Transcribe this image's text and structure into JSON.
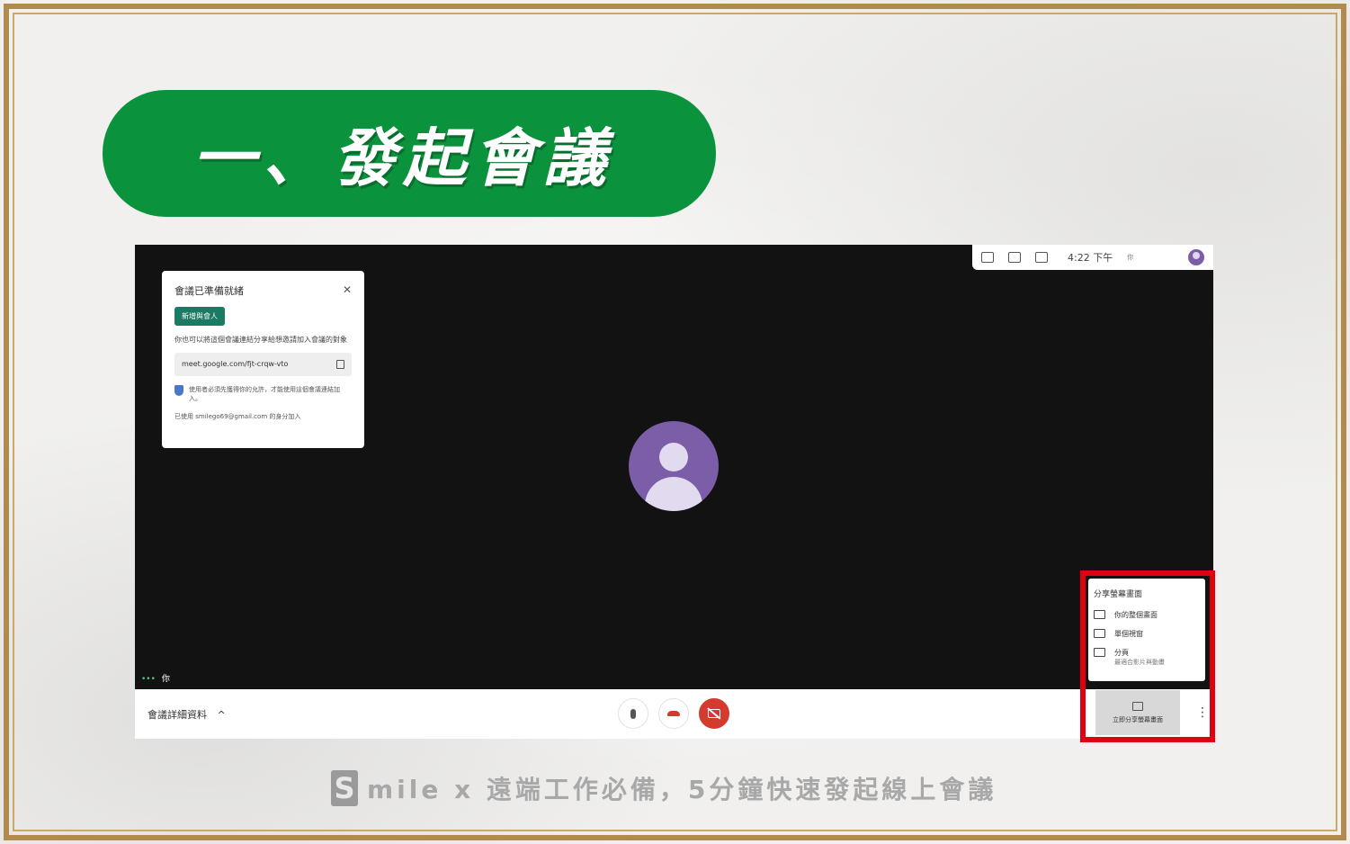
{
  "title": "一、發起會議",
  "topbar": {
    "time": "4:22 下午",
    "you_short": "你"
  },
  "ready_card": {
    "heading": "會議已準備就緒",
    "close": "✕",
    "add_button": "新增與會人",
    "description": "你也可以將這個會議連結分享給想邀請加入會議的對象",
    "link": "meet.google.com/fjt-crqw-vto",
    "security": "使用者必須先獲得你的允許，才能使用這個會議連結加入。",
    "joined_as": "已使用 smilego69@gmail.com 的身分加入"
  },
  "you_label": "你",
  "you_dots": "•••",
  "bottom": {
    "details": "會議詳細資料",
    "chevron": "^"
  },
  "share_panel": {
    "title": "分享螢幕畫面",
    "items": [
      {
        "label": "你的整個畫面",
        "sub": ""
      },
      {
        "label": "單個視窗",
        "sub": ""
      },
      {
        "label": "分頁",
        "sub": "最適合影片與動畫"
      }
    ]
  },
  "present_button": "立即分享螢幕畫面",
  "more": "⋮",
  "footer": {
    "logo": "S",
    "text": "mile x 遠端工作必備，5分鐘快速發起線上會議"
  },
  "colors": {
    "brand_green": "#0b923c",
    "highlight_red": "#e00012",
    "avatar_purple": "#7b5ea7",
    "hangup_red": "#d23b2e"
  }
}
